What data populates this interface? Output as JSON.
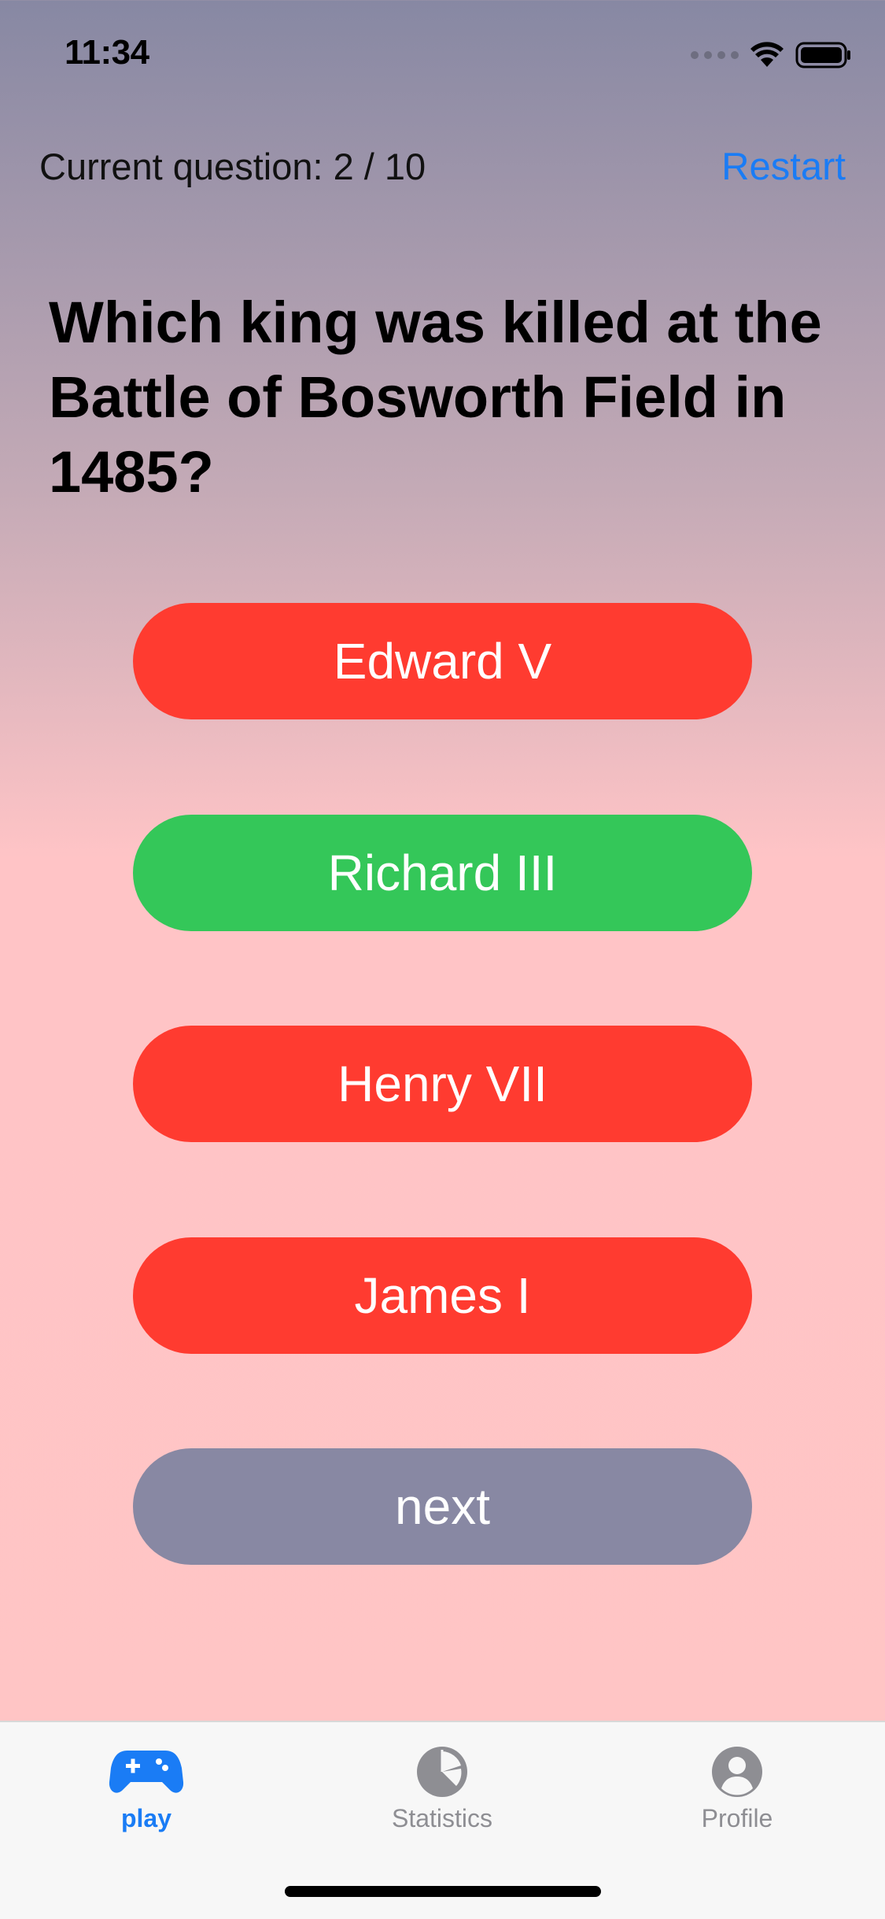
{
  "status_bar": {
    "time": "11:34",
    "icons": [
      "cellular-signal-icon",
      "wifi-icon",
      "battery-icon"
    ]
  },
  "header": {
    "counter": "Current question: 2 / 10",
    "restart_label": "Restart"
  },
  "question": {
    "text": "Which king was killed at the Battle of Bosworth Field in 1485?"
  },
  "answers": [
    {
      "label": "Edward V",
      "state": "incorrect",
      "color": "#ff3b30"
    },
    {
      "label": "Richard III",
      "state": "correct",
      "color": "#34c759"
    },
    {
      "label": "Henry VII",
      "state": "incorrect",
      "color": "#ff3b30"
    },
    {
      "label": "James I",
      "state": "incorrect",
      "color": "#ff3b30"
    }
  ],
  "next_button": {
    "label": "next",
    "color": "#8888a3"
  },
  "tabs": [
    {
      "label": "play",
      "icon": "gamecontroller-icon",
      "active": true
    },
    {
      "label": "Statistics",
      "icon": "pie-chart-icon",
      "active": false
    },
    {
      "label": "Profile",
      "icon": "person-circle-icon",
      "active": false
    }
  ],
  "colors": {
    "accent": "#1a7cf5",
    "inactive_tab": "#8e8e93",
    "background_top": "#8788a3",
    "background_bottom": "#ffc5c5"
  }
}
